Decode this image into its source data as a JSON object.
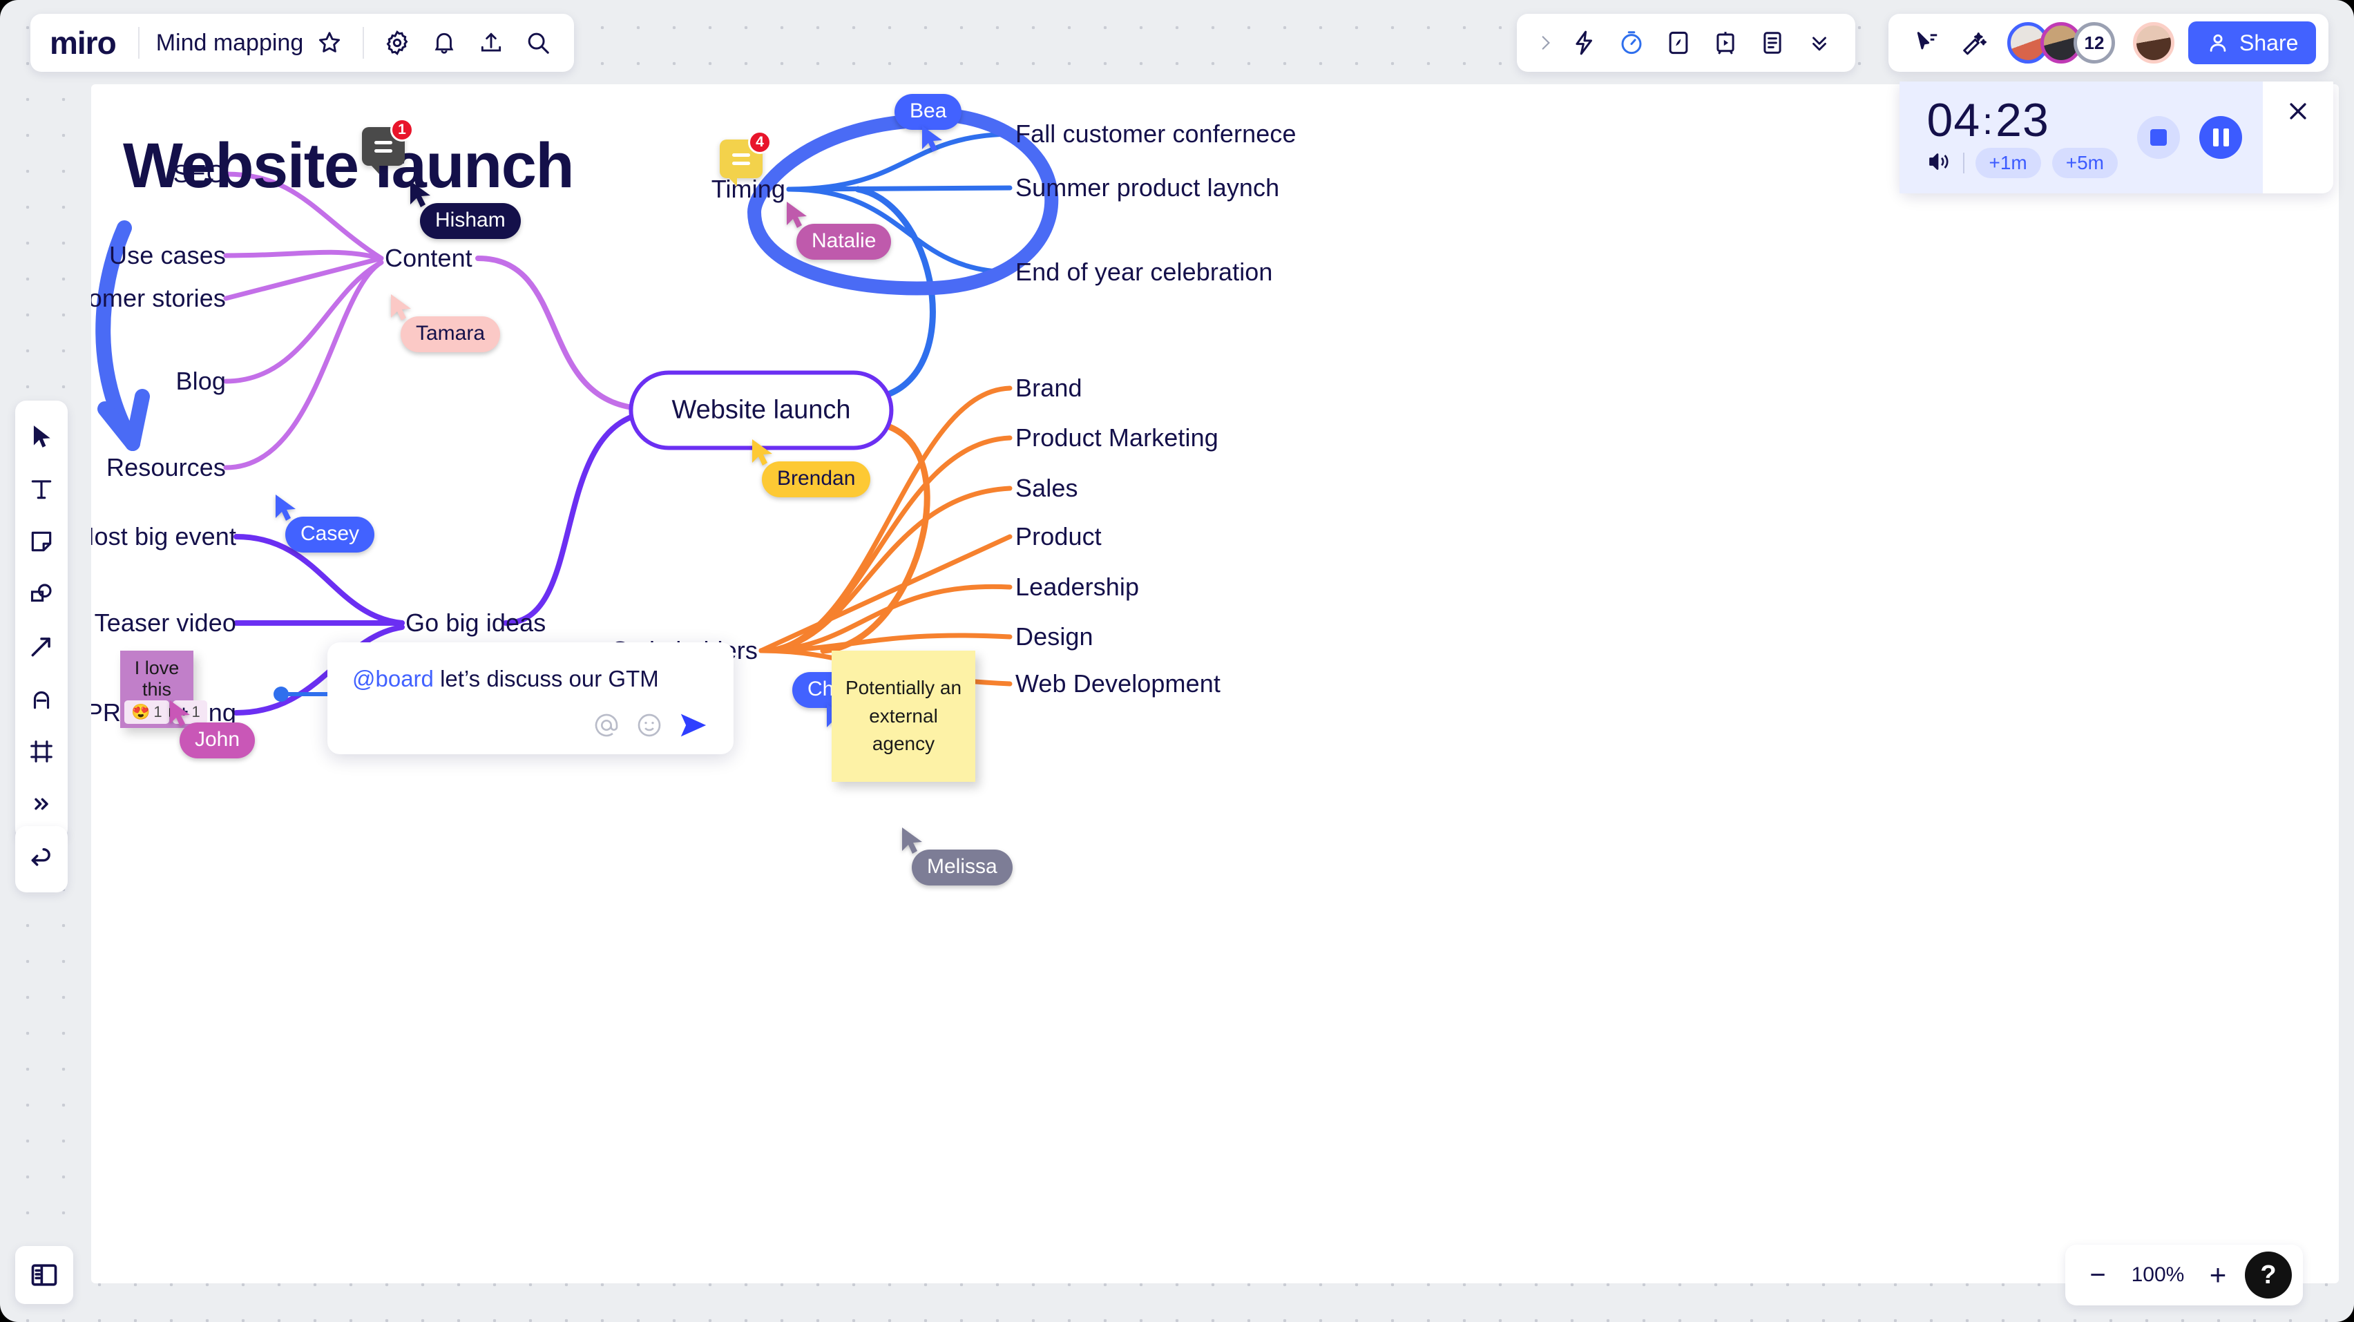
{
  "header": {
    "logo": "miro",
    "board_name": "Mind mapping",
    "icons": [
      "star-icon",
      "gear-icon",
      "bell-icon",
      "upload-icon",
      "search-icon"
    ],
    "right_icons": [
      "chevron-right-icon",
      "lightning-icon",
      "timer-icon",
      "media-icon",
      "presentation-icon",
      "notes-icon",
      "chevrons-down-icon"
    ],
    "collab_icons": [
      "cursor-share-icon",
      "reactions-icon"
    ],
    "avatar_overflow": "12",
    "share_label": "Share"
  },
  "toolbar": {
    "items": [
      {
        "name": "select-tool",
        "icon": "cursor-icon"
      },
      {
        "name": "text-tool",
        "icon": "text-icon"
      },
      {
        "name": "sticky-note-tool",
        "icon": "sticky-note-icon"
      },
      {
        "name": "shapes-tool",
        "icon": "shapes-icon"
      },
      {
        "name": "connector-tool",
        "icon": "arrow-icon"
      },
      {
        "name": "pen-tool",
        "icon": "pen-icon"
      },
      {
        "name": "frame-tool",
        "icon": "frame-icon"
      },
      {
        "name": "more-tools",
        "icon": "chevrons-right-icon"
      }
    ],
    "undo_icon": "undo-icon"
  },
  "timer": {
    "minutes": "04",
    "separator": ":",
    "seconds": "23",
    "sound_icon": "volume-icon",
    "add_1m": "+1m",
    "add_5m": "+5m",
    "stop_label": "stop",
    "pause_label": "pause",
    "close_label": "close"
  },
  "zoom": {
    "minus": "−",
    "value": "100%",
    "plus": "+",
    "help": "?"
  },
  "board": {
    "title": "Website launch",
    "root": "Website launch",
    "title_comment_count": "1",
    "timing_comment_count": "4",
    "branches": {
      "content": {
        "label": "Content",
        "children": [
          "SEO",
          "Use cases",
          "Customer stories",
          "Blog",
          "Resources"
        ],
        "color": "#c36fe8"
      },
      "go_big_ideas": {
        "label": "Go big ideas",
        "children": [
          "Host big event",
          "Teaser video",
          "PR campaing"
        ],
        "color": "#6b2ff2"
      },
      "timing": {
        "label": "Timing",
        "children": [
          "Fall customer confernece",
          "Summer product laynch",
          "End of year celebration"
        ],
        "color": "#2f6fed"
      },
      "stakeholders": {
        "label": "Stakeholders",
        "children": [
          "Brand",
          "Product Marketing",
          "Sales",
          "Product",
          "Leadership",
          "Design",
          "Web Development"
        ],
        "color": "#f6812e"
      }
    },
    "sticky_notes": [
      {
        "text": "I love this idea!",
        "color": "#c17fc9",
        "reactions": [
          {
            "emoji": "😍",
            "count": "1"
          },
          {
            "emoji": "+",
            "count": "1"
          }
        ]
      },
      {
        "text": "Potentially an external agency",
        "color": "#fdf2a6",
        "reactions": []
      }
    ],
    "composer": {
      "mention": "@board",
      "text": " let’s discuss our GTM",
      "icons": [
        "mention-icon",
        "emoji-icon",
        "send-icon"
      ]
    },
    "cursors": [
      {
        "name": "Hisham",
        "color": "#14104a",
        "text_color": "#ffffff"
      },
      {
        "name": "Tamara",
        "color": "#fbc9c6",
        "text_color": "#14104a"
      },
      {
        "name": "Casey",
        "color": "#4262ff",
        "text_color": "#ffffff"
      },
      {
        "name": "Brendan",
        "color": "#fdc934",
        "text_color": "#14104a"
      },
      {
        "name": "Natalie",
        "color": "#bf5aac",
        "text_color": "#ffffff"
      },
      {
        "name": "Bea",
        "color": "#4262ff",
        "text_color": "#ffffff"
      },
      {
        "name": "Chris",
        "color": "#4262ff",
        "text_color": "#ffffff"
      },
      {
        "name": "John",
        "color": "#c957b7",
        "text_color": "#ffffff"
      },
      {
        "name": "Melissa",
        "color": "#7d7d96",
        "text_color": "#ffffff"
      }
    ],
    "annotations": {
      "blue_arrow": "hand-drawn-down-arrow",
      "blue_circle": "hand-drawn-circle-highlight",
      "color": "#4a6bf5"
    }
  }
}
